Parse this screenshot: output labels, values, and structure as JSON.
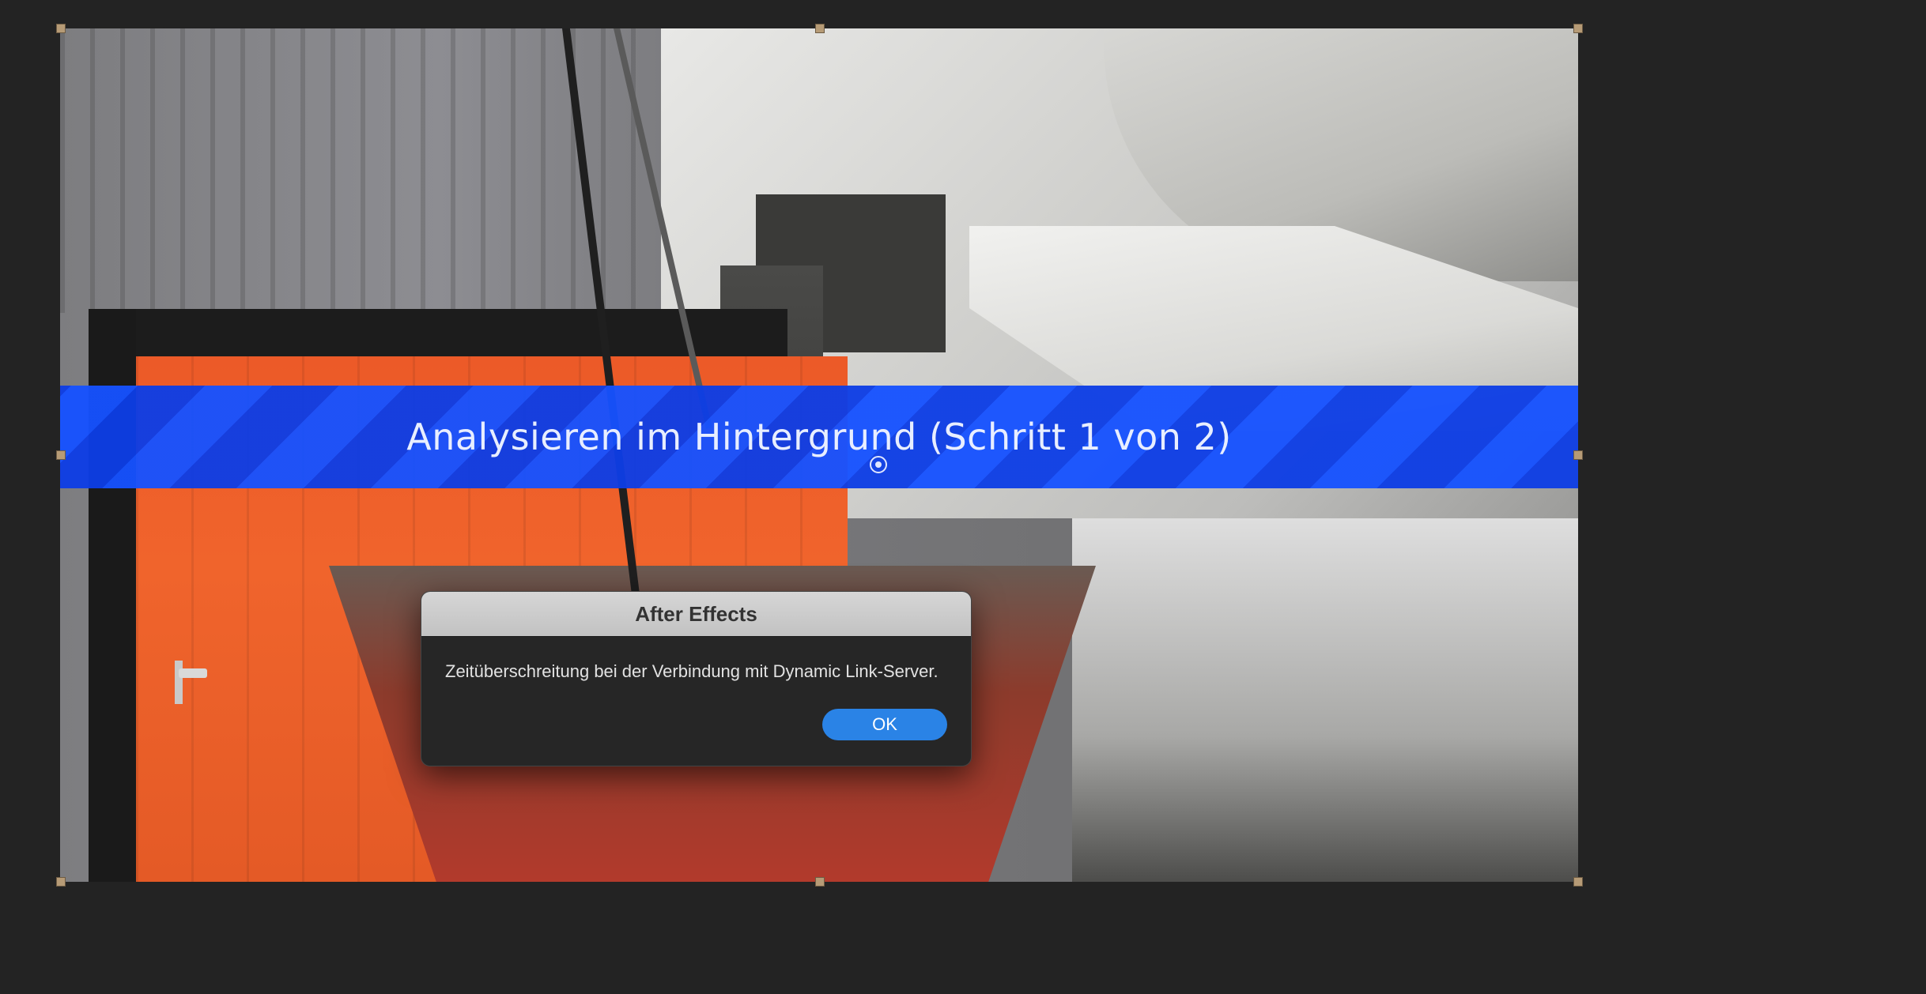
{
  "viewer": {
    "banner_text": "Analysieren im Hintergrund (Schritt 1 von 2)"
  },
  "dialog": {
    "title": "After Effects",
    "message": "Zeitüberschreitung bei der Verbindung mit Dynamic Link-Server.",
    "ok_label": "OK"
  },
  "colors": {
    "background": "#232323",
    "banner_blue": "#0a46ff",
    "handle": "#b69b76",
    "ok_button": "#2a83e6"
  }
}
